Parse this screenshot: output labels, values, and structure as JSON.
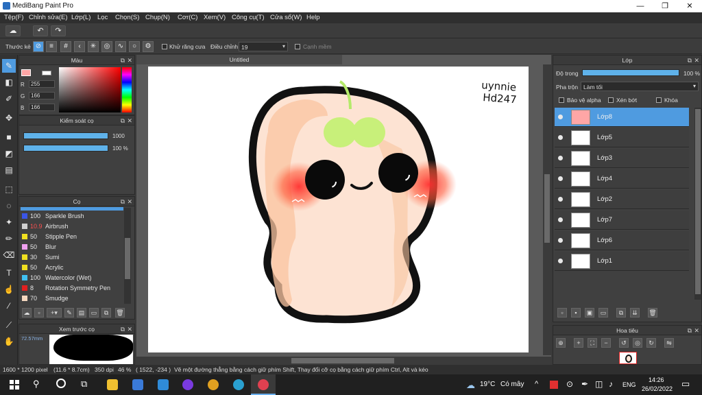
{
  "window": {
    "title": "MediBang Paint Pro",
    "minimize": "—",
    "restore": "❐",
    "close": "✕"
  },
  "menu": [
    "Tệp(F)",
    "Chỉnh sửa(E)",
    "Lớp(L)",
    "Lọc",
    "Chọn(S)",
    "Chụp(N)",
    "Cơr(C)",
    "Xem(V)",
    "Công cụ(T)",
    "Cửa sổ(W)",
    "Help"
  ],
  "toolbar2": {
    "ruler_label": "Thước kẻ",
    "antialias_label": "Khử răng cưa",
    "adjust_label": "Điều chỉnh",
    "adjust_value": "19",
    "smooth_label": "Cạnh mềm"
  },
  "color_panel": {
    "title": "Màu",
    "r_label": "R",
    "g_label": "G",
    "b_label": "B",
    "r": "255",
    "g": "166",
    "b": "166",
    "current_color": "#ffa6a6"
  },
  "brush_control": {
    "title": "Kiểm soát cọ",
    "size": "1000",
    "opacity": "100 %",
    "size_fraction": 1.0,
    "opacity_fraction": 1.0
  },
  "brush_panel": {
    "title": "Cọ",
    "brushes": [
      {
        "size": "100",
        "name": "Sparkle Brush",
        "color": "#3a55e6",
        "size_color": "#e6e6e6"
      },
      {
        "size": "10.9",
        "name": "Airbrush",
        "color": "#d0d0d0",
        "size_color": "#ff5050"
      },
      {
        "size": "50",
        "name": "Stipple Pen",
        "color": "#f0e020",
        "size_color": "#e6e6e6"
      },
      {
        "size": "50",
        "name": "Blur",
        "color": "#f0a0f0",
        "size_color": "#e6e6e6"
      },
      {
        "size": "30",
        "name": "Sumi",
        "color": "#f0e020",
        "size_color": "#e6e6e6"
      },
      {
        "size": "50",
        "name": "Acrylic",
        "color": "#f0e020",
        "size_color": "#e6e6e6"
      },
      {
        "size": "100",
        "name": "Watercolor (Wet)",
        "color": "#40c0f0",
        "size_color": "#e6e6e6"
      },
      {
        "size": "8",
        "name": "Rotation Symmetry Pen",
        "color": "#e02020",
        "size_color": "#e6e6e6"
      },
      {
        "size": "70",
        "name": "Smudge",
        "color": "#f5d8c0",
        "size_color": "#e6e6e6"
      }
    ]
  },
  "brush_preview": {
    "title": "Xem trước cọ",
    "size_label": "72.57mm"
  },
  "document": {
    "tab_title": "Untitled",
    "signature_line1": "uynnie",
    "signature_line2": "Hd247"
  },
  "layer_panel": {
    "title": "Lớp",
    "opacity_label": "Độ trong",
    "opacity_value": "100 %",
    "opacity_fraction": 1.0,
    "blend_label": "Pha trộn",
    "blend_value": "Làm tối",
    "protect_alpha": "Bảo vệ alpha",
    "clipping": "Xén bớt",
    "lock": "Khóa",
    "layers": [
      {
        "name": "Lớp8",
        "selected": true
      },
      {
        "name": "Lớp5",
        "selected": false
      },
      {
        "name": "Lớp3",
        "selected": false
      },
      {
        "name": "Lớp4",
        "selected": false
      },
      {
        "name": "Lớp2",
        "selected": false
      },
      {
        "name": "Lớp7",
        "selected": false
      },
      {
        "name": "Lớp6",
        "selected": false
      },
      {
        "name": "Lớp1",
        "selected": false
      }
    ]
  },
  "navigator": {
    "title": "Hoa tiêu"
  },
  "status": {
    "size": "1600 * 1200 pixel",
    "dims": "(11.6 * 8.7cm)",
    "dpi": "350 dpi",
    "zoom": "46 %",
    "coords": "( 1522, -234 )",
    "hint": "Vẽ một đường thẳng bằng cách giữ phím Shift, Thay đổi cỡ cọ bằng cách giữ phím Ctrl, Alt và kéo"
  },
  "taskbar": {
    "weather": "19°C",
    "weather_text": "Có mây",
    "lang": "ENG",
    "time": "14:26",
    "date": "26/02/2022"
  },
  "colors": {
    "accent": "#4f9be0",
    "panel_bg": "#404040",
    "canvas_bg": "#5a5a5a"
  }
}
